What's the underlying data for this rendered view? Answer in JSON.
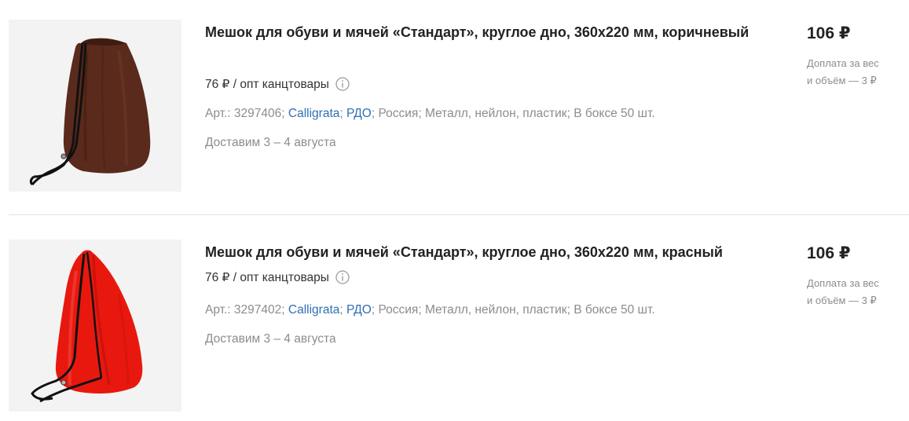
{
  "products": [
    {
      "title": "Мешок для обуви и мячей «Стандарт», круглое дно, 360х220 мм, коричневый",
      "wholesale": "76 ₽ / опт канцтовары",
      "article": "Арт.: 3297406",
      "brand": "Calligrata",
      "manufacturer": "РДО",
      "country": "Россия",
      "material": "Металл, нейлон, пластик",
      "box": "В боксе 50 шт.",
      "delivery": "Доставим 3 – 4 августа",
      "price": "106 ₽",
      "surcharge_line1": "Доплата за вес",
      "surcharge_line2": "и объём — 3 ₽",
      "bag_color": "#5a2a1c"
    },
    {
      "title": "Мешок для обуви и мячей «Стандарт», круглое дно, 360х220 мм, красный",
      "wholesale": "76 ₽ / опт канцтовары",
      "article": "Арт.: 3297402",
      "brand": "Calligrata",
      "manufacturer": "РДО",
      "country": "Россия",
      "material": "Металл, нейлон, пластик",
      "box": "В боксе 50 шт.",
      "delivery": "Доставим 3 – 4 августа",
      "price": "106 ₽",
      "surcharge_line1": "Доплата за вес",
      "surcharge_line2": "и объём — 3 ₽",
      "bag_color": "#e8180f"
    }
  ],
  "separator": "; ",
  "info_icon": "info-circle-icon",
  "colors": {
    "link": "#2f6fb5",
    "muted": "#8c8c8c",
    "text": "#222222"
  }
}
